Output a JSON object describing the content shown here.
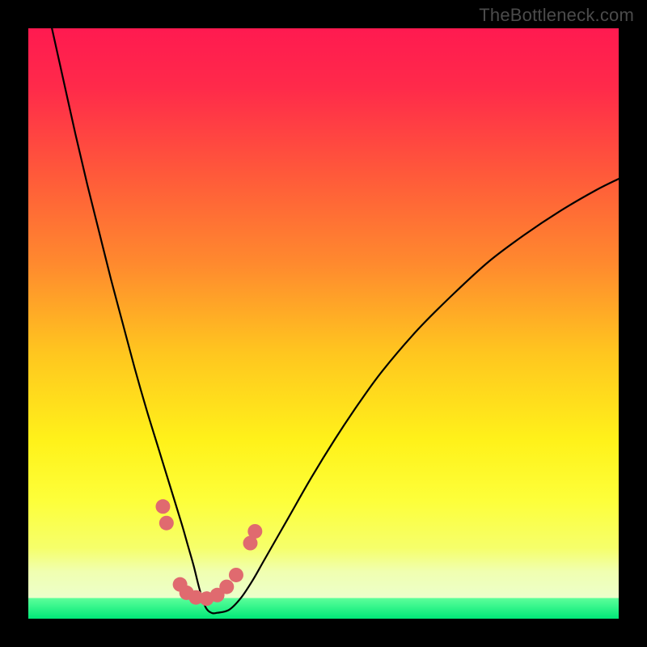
{
  "watermark": "TheBottleneck.com",
  "chart_data": {
    "type": "line",
    "title": "",
    "xlabel": "",
    "ylabel": "",
    "xlim": [
      0,
      100
    ],
    "ylim": [
      0,
      100
    ],
    "background_gradient": {
      "main_stops": [
        {
          "offset": 0.0,
          "color": "#ff1a50"
        },
        {
          "offset": 0.1,
          "color": "#ff2a4a"
        },
        {
          "offset": 0.25,
          "color": "#ff5a3a"
        },
        {
          "offset": 0.4,
          "color": "#ff8a2e"
        },
        {
          "offset": 0.55,
          "color": "#ffc61f"
        },
        {
          "offset": 0.7,
          "color": "#fff21a"
        },
        {
          "offset": 0.8,
          "color": "#fdff3a"
        },
        {
          "offset": 0.88,
          "color": "#f6ff6a"
        },
        {
          "offset": 0.92,
          "color": "#f0ffb0"
        },
        {
          "offset": 1.0,
          "color": "#e9ffe0"
        }
      ],
      "green_band": {
        "top_fraction": 0.965,
        "color_top": "#5dff9a",
        "color_bottom": "#00e878"
      }
    },
    "series": [
      {
        "name": "bottleneck-curve",
        "stroke": "#000000",
        "stroke_width": 2.2,
        "x": [
          4,
          6,
          8,
          10,
          12,
          14,
          16,
          18,
          20,
          22,
          24,
          26,
          27,
          28,
          29,
          30,
          31,
          32,
          34,
          36,
          38,
          40,
          44,
          48,
          52,
          56,
          60,
          66,
          72,
          78,
          84,
          90,
          96,
          100
        ],
        "y": [
          100,
          91,
          82,
          73.5,
          65.5,
          57.5,
          50,
          42.5,
          35.5,
          29,
          22.5,
          16,
          12.5,
          9,
          5,
          2,
          1,
          1,
          1.5,
          3.5,
          6.5,
          10,
          17,
          24,
          30.5,
          36.5,
          42,
          49,
          55,
          60.5,
          65,
          69,
          72.5,
          74.5
        ]
      }
    ],
    "markers": {
      "color": "#e06a6f",
      "radius": 9,
      "points": [
        {
          "x": 22.8,
          "y": 19.0
        },
        {
          "x": 23.4,
          "y": 16.2
        },
        {
          "x": 25.7,
          "y": 5.8
        },
        {
          "x": 26.8,
          "y": 4.4
        },
        {
          "x": 28.4,
          "y": 3.6
        },
        {
          "x": 30.2,
          "y": 3.4
        },
        {
          "x": 32.0,
          "y": 4.0
        },
        {
          "x": 33.6,
          "y": 5.4
        },
        {
          "x": 35.2,
          "y": 7.4
        },
        {
          "x": 37.6,
          "y": 12.8
        },
        {
          "x": 38.4,
          "y": 14.8
        }
      ]
    }
  }
}
